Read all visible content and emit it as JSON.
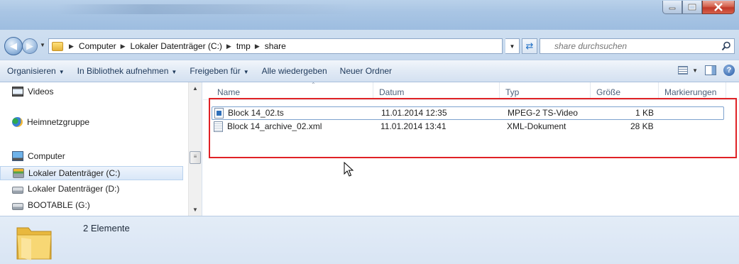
{
  "window": {
    "controls": {
      "minimize": "minimize-icon",
      "maximize": "maximize-icon",
      "close": "close-icon"
    }
  },
  "address": {
    "crumbs": [
      "Computer",
      "Lokaler Datenträger (C:)",
      "tmp",
      "share"
    ],
    "search_placeholder": "share durchsuchen"
  },
  "toolbar": {
    "organize": "Organisieren",
    "library": "In Bibliothek aufnehmen",
    "share": "Freigeben für",
    "play_all": "Alle wiedergeben",
    "new_folder": "Neuer Ordner"
  },
  "nav": {
    "items": [
      {
        "label": "Videos",
        "icon": "video-library-icon"
      },
      {
        "label": "Heimnetzgruppe",
        "icon": "homegroup-icon"
      },
      {
        "label": "Computer",
        "icon": "computer-icon"
      },
      {
        "label": "Lokaler Datenträger (C:)",
        "icon": "system-drive-icon"
      },
      {
        "label": "Lokaler Datenträger (D:)",
        "icon": "drive-icon"
      },
      {
        "label": "BOOTABLE (G:)",
        "icon": "drive-icon"
      }
    ]
  },
  "filelist": {
    "columns": [
      "Name",
      "Datum",
      "Typ",
      "Größe",
      "Markierungen"
    ],
    "rows": [
      {
        "name": "Block 14_02.ts",
        "date": "11.01.2014 12:35",
        "type": "MPEG-2 TS-Video",
        "size": "1 KB",
        "icon": "video-file-icon"
      },
      {
        "name": "Block 14_archive_02.xml",
        "date": "11.01.2014 13:41",
        "type": "XML-Dokument",
        "size": "28 KB",
        "icon": "xml-file-icon"
      }
    ]
  },
  "details": {
    "count": "2 Elemente"
  },
  "colors": {
    "highlight": "#e02226",
    "accent": "#1e395b"
  }
}
